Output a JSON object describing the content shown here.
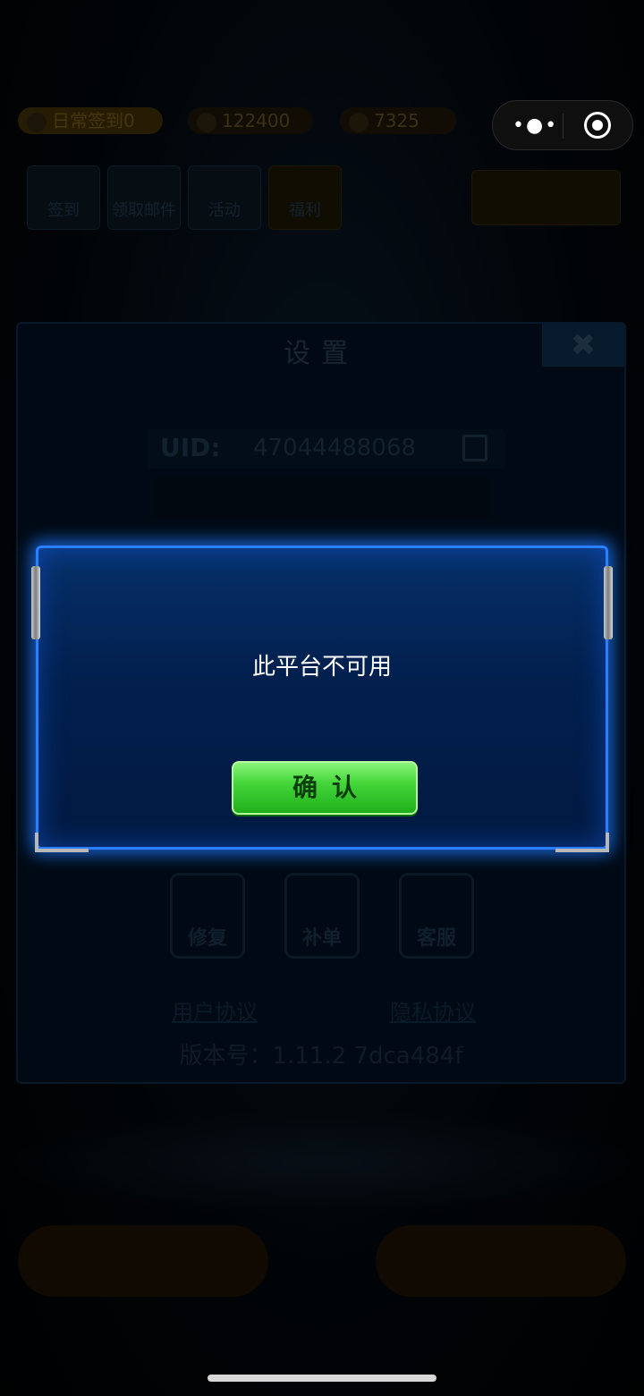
{
  "topbar": {
    "resource1": "日常签到0",
    "resource2": "122400",
    "resource3": "7325"
  },
  "capsule": {
    "more_icon": "more-dots-icon",
    "close_icon": "target-circle-icon"
  },
  "menu": {
    "items": [
      "签到",
      "领取邮件",
      "活动",
      "福利"
    ]
  },
  "settings": {
    "title": "设置",
    "close_glyph": "✖",
    "uid_label": "UID:",
    "uid_value": "47044488068",
    "tools": [
      "修复",
      "补单",
      "客服"
    ],
    "user_agreement": "用户协议",
    "privacy_agreement": "隐私协议",
    "version": "版本号：1.11.2  7dca484f"
  },
  "dialog": {
    "message": "此平台不可用",
    "confirm_label": "确认"
  },
  "colors": {
    "dialog_border": "#2a7fff",
    "dialog_bg": "#021f4d",
    "confirm_green": "#45d63a"
  }
}
